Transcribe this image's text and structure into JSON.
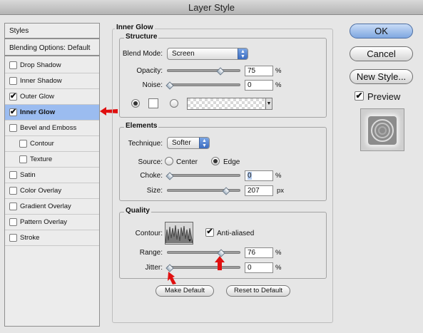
{
  "window": {
    "title": "Layer Style"
  },
  "sidebar": {
    "header": "Styles",
    "blending_options": "Blending Options: Default",
    "items": [
      {
        "label": "Drop Shadow",
        "checked": false,
        "indent": false,
        "selected": false
      },
      {
        "label": "Inner Shadow",
        "checked": false,
        "indent": false,
        "selected": false
      },
      {
        "label": "Outer Glow",
        "checked": true,
        "indent": false,
        "selected": false
      },
      {
        "label": "Inner Glow",
        "checked": true,
        "indent": false,
        "selected": true
      },
      {
        "label": "Bevel and Emboss",
        "checked": false,
        "indent": false,
        "selected": false
      },
      {
        "label": "Contour",
        "checked": false,
        "indent": true,
        "selected": false
      },
      {
        "label": "Texture",
        "checked": false,
        "indent": true,
        "selected": false
      },
      {
        "label": "Satin",
        "checked": false,
        "indent": false,
        "selected": false
      },
      {
        "label": "Color Overlay",
        "checked": false,
        "indent": false,
        "selected": false
      },
      {
        "label": "Gradient Overlay",
        "checked": false,
        "indent": false,
        "selected": false
      },
      {
        "label": "Pattern Overlay",
        "checked": false,
        "indent": false,
        "selected": false
      },
      {
        "label": "Stroke",
        "checked": false,
        "indent": false,
        "selected": false
      }
    ],
    "check_mark": "✔"
  },
  "panel": {
    "title": "Inner Glow",
    "structure": {
      "title": "Structure",
      "blend_mode_label": "Blend Mode:",
      "blend_mode_value": "Screen",
      "opacity_label": "Opacity:",
      "opacity_value": "75",
      "opacity_unit": "%",
      "opacity_level": 0.75,
      "noise_label": "Noise:",
      "noise_value": "0",
      "noise_unit": "%",
      "noise_level": 0.0
    },
    "elements": {
      "title": "Elements",
      "technique_label": "Technique:",
      "technique_value": "Softer",
      "source_label": "Source:",
      "source_center": "Center",
      "source_edge": "Edge",
      "choke_label": "Choke:",
      "choke_value": "0",
      "choke_unit": "%",
      "choke_level": 0.0,
      "size_label": "Size:",
      "size_value": "207",
      "size_unit": "px",
      "size_level": 0.83
    },
    "quality": {
      "title": "Quality",
      "contour_label": "Contour:",
      "anti_aliased_label": "Anti-aliased",
      "anti_aliased_checked": true,
      "range_label": "Range:",
      "range_value": "76",
      "range_unit": "%",
      "range_level": 0.76,
      "jitter_label": "Jitter:",
      "jitter_value": "0",
      "jitter_unit": "%",
      "jitter_level": 0.0
    },
    "make_default": "Make Default",
    "reset_default": "Reset to Default"
  },
  "actions": {
    "ok": "OK",
    "cancel": "Cancel",
    "new_style": "New Style...",
    "preview_label": "Preview",
    "preview_checked": true
  },
  "colors": {
    "selection": "#9bbcf0",
    "arrow": "#e01010"
  }
}
